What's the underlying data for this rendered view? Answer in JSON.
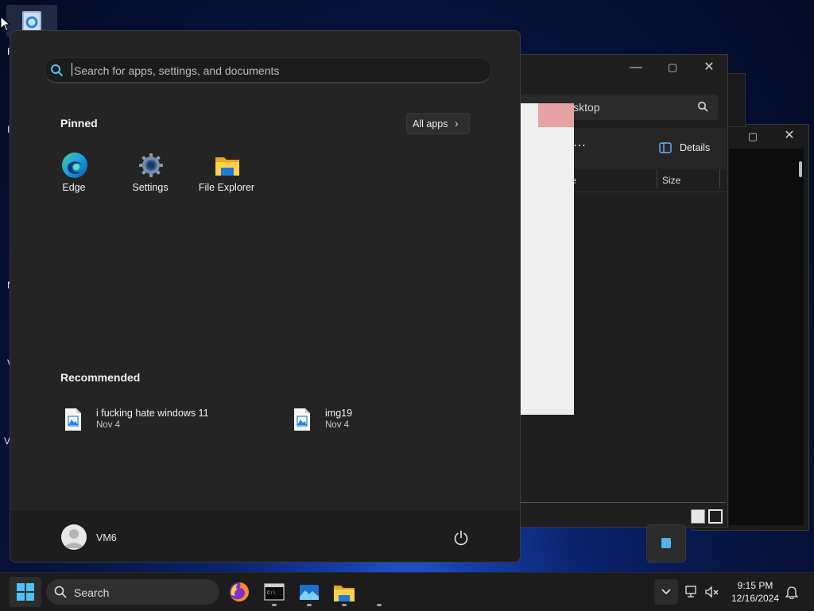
{
  "desktop": {
    "side_letters": [
      "R",
      "I",
      "N",
      "V",
      "V"
    ]
  },
  "explorer_window": {
    "search_text": "Search Desktop",
    "details_label": "Details",
    "col_type": "Type",
    "col_size": "Size"
  },
  "start_menu": {
    "search_placeholder": "Search for apps, settings, and documents",
    "pinned_title": "Pinned",
    "all_apps_label": "All apps",
    "pinned_apps": [
      {
        "name": "Edge",
        "icon": "edge-icon"
      },
      {
        "name": "Settings",
        "icon": "settings-gear-icon"
      },
      {
        "name": "File Explorer",
        "icon": "folder-icon"
      }
    ],
    "recommended_title": "Recommended",
    "recommended": [
      {
        "name": "i fucking hate windows 11",
        "date": "Nov 4",
        "icon": "image-file-icon"
      },
      {
        "name": "img19",
        "date": "Nov 4",
        "icon": "image-file-icon"
      }
    ],
    "user_name": "VM6",
    "power_icon": "power-icon"
  },
  "taskbar": {
    "search_label": "Search",
    "apps": [
      "firefox-icon",
      "terminal-icon",
      "photos-icon",
      "file-explorer-icon"
    ],
    "time": "9:15 PM",
    "date": "12/16/2024"
  },
  "colors": {
    "accent": "#0078d4",
    "start_bg": "#242424",
    "taskbar_bg": "#1c1c1c"
  }
}
